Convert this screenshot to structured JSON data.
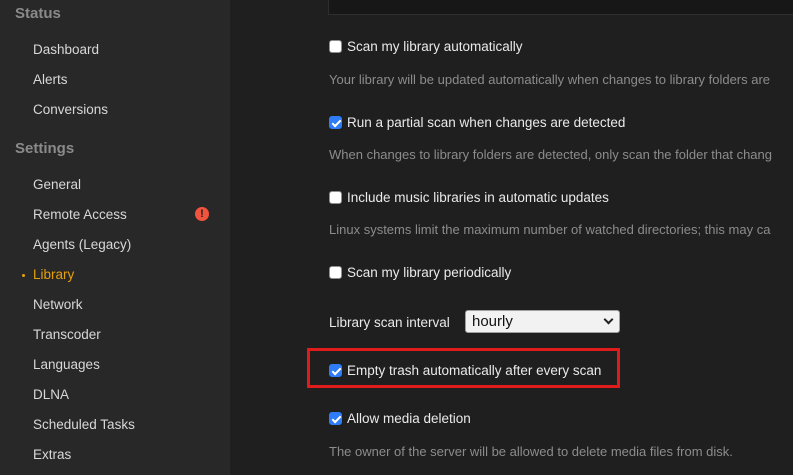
{
  "sidebar": {
    "sections": [
      {
        "title": "Status"
      },
      {
        "title": "Settings"
      }
    ],
    "status_items": [
      {
        "label": "Dashboard"
      },
      {
        "label": "Alerts"
      },
      {
        "label": "Conversions"
      }
    ],
    "settings_items": [
      {
        "label": "General"
      },
      {
        "label": "Remote Access"
      },
      {
        "label": "Agents (Legacy)"
      },
      {
        "label": "Library"
      },
      {
        "label": "Network"
      },
      {
        "label": "Transcoder"
      },
      {
        "label": "Languages"
      },
      {
        "label": "DLNA"
      },
      {
        "label": "Scheduled Tasks"
      },
      {
        "label": "Extras"
      }
    ],
    "active_item": "Library",
    "warning_icon_glyph": "!"
  },
  "settings": {
    "scan_auto": {
      "label": "Scan my library automatically",
      "checked": false,
      "desc": "Your library will be updated automatically when changes to library folders are"
    },
    "partial_scan": {
      "label": "Run a partial scan when changes are detected",
      "checked": true,
      "desc": "When changes to library folders are detected, only scan the folder that chang"
    },
    "music_updates": {
      "label": "Include music libraries in automatic updates",
      "checked": false,
      "desc": "Linux systems limit the maximum number of watched directories; this may ca"
    },
    "scan_periodic": {
      "label": "Scan my library periodically",
      "checked": false
    },
    "interval": {
      "label": "Library scan interval",
      "value": "hourly"
    },
    "empty_trash": {
      "label": "Empty trash automatically after every scan",
      "checked": true
    },
    "media_deletion": {
      "label": "Allow media deletion",
      "checked": true,
      "desc": "The owner of the server will be allowed to delete media files from disk."
    }
  },
  "colors": {
    "accent": "#e5a00d",
    "checkbox": "#2e7cf6",
    "warning": "#f0533e",
    "highlight": "#e01b1b"
  }
}
